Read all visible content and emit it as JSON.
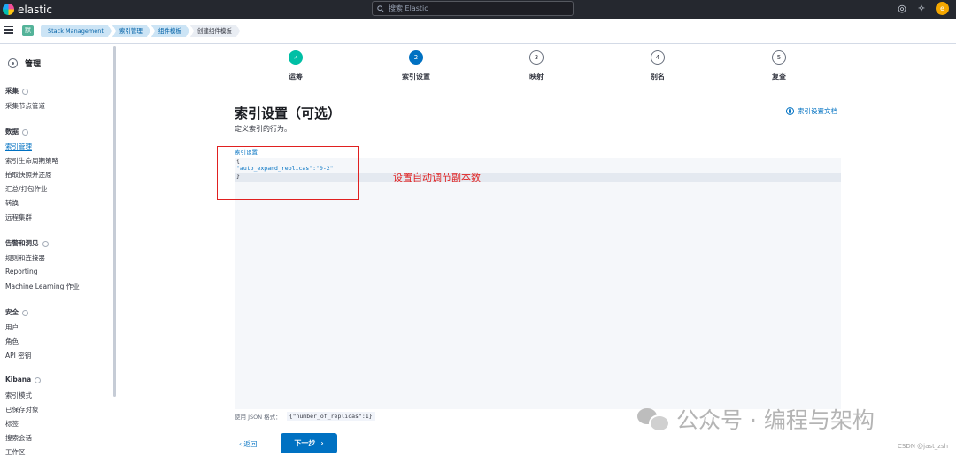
{
  "topbar": {
    "brand": "elastic",
    "search_placeholder": "搜索 Elastic",
    "avatar_initial": "e"
  },
  "breadcrumbs": {
    "space_badge": "默",
    "items": [
      "Stack Management",
      "索引管理",
      "组件模板",
      "创建组件模板"
    ]
  },
  "sidebar": {
    "title": "管理",
    "sections": [
      {
        "title": "采集",
        "items": [
          "采集节点管道"
        ]
      },
      {
        "title": "数据",
        "items": [
          "索引管理",
          "索引生命周期策略",
          "拍取快照并还原",
          "汇总/打包作业",
          "转换",
          "远程集群"
        ]
      },
      {
        "title": "告警和洞见",
        "items": [
          "规则和连接器",
          "Reporting",
          "Machine Learning 作业"
        ]
      },
      {
        "title": "安全",
        "items": [
          "用户",
          "角色",
          "API 密钥"
        ]
      },
      {
        "title": "Kibana",
        "items": [
          "索引模式",
          "已保存对象",
          "标签",
          "搜索会话",
          "工作区"
        ]
      }
    ],
    "active_item": "索引管理"
  },
  "steps": [
    {
      "number": "✓",
      "label": "运筹",
      "state": "done"
    },
    {
      "number": "2",
      "label": "索引设置",
      "state": "current"
    },
    {
      "number": "3",
      "label": "映射",
      "state": "todo"
    },
    {
      "number": "4",
      "label": "别名",
      "state": "todo"
    },
    {
      "number": "5",
      "label": "复查",
      "state": "todo"
    }
  ],
  "page": {
    "title": "索引设置（可选）",
    "description": "定义索引的行为。",
    "doc_link": "索引设置文档",
    "editor_label": "索引设置",
    "code_lines": [
      "{",
      "\"auto_expand_replicas\":\"0-2\"",
      "}"
    ],
    "help_prefix": "使用 JSON 格式：",
    "help_example": "{\"number_of_replicas\":1}",
    "back_label": "返回",
    "next_label": "下一步"
  },
  "annotation": {
    "text": "设置自动调节副本数",
    "color": "#e02020"
  },
  "watermark": {
    "text": "公众号 · 编程与架构",
    "credit": "CSDN @jast_zsh"
  },
  "colors": {
    "primary": "#0071c2",
    "success": "#00bfa5",
    "topbar": "#25282f"
  }
}
